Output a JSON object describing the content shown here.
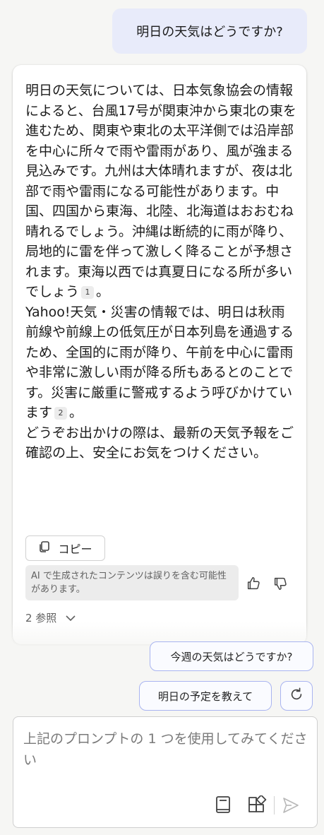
{
  "user_message": "明日の天気はどうですか?",
  "answer": {
    "para1": "明日の天気については、日本気象協会の情報によると、台風17号が関東沖から東北の東を進むため、関東や東北の太平洋側では沿岸部を中心に所々で雨や雷雨があり、風が強まる見込みです。九州は大体晴れますが、夜は北部で雨や雷雨になる可能性があります。中国、四国から東海、北陸、北海道はおおむね晴れるでしょう。沖縄は断続的に雨が降り、局地的に雷を伴って激しく降ることが予想されます。東海以西では真夏日になる所が多いでしょう",
    "cite1": "1",
    "para1_end": "。",
    "para2": "Yahoo!天気・災害の情報では、明日は秋雨前線や前線上の低気圧が日本列島を通過するため、全国的に雨が降り、午前を中心に雷雨や非常に激しい雨が降る所もあるとのことです。災害に厳重に警戒するよう呼びかけています",
    "cite2": "2",
    "para2_end": "。",
    "para3": "どうぞお出かけの際は、最新の天気予報をご確認の上、安全にお気をつけください。"
  },
  "copy_label": "コピー",
  "disclaimer": "AI で生成されたコンテンツは誤りを含む可能性があります。",
  "references_label": "2 参照",
  "suggestions": [
    "今週の天気はどうですか?",
    "明日の予定を教えて"
  ],
  "composer": {
    "placeholder": "上記のプロンプトの 1 つを使用してみてください"
  },
  "colors": {
    "user_bubble": "#e8ebfa",
    "chip_border": "#a9b4f0",
    "background": "#f6f6f4"
  }
}
